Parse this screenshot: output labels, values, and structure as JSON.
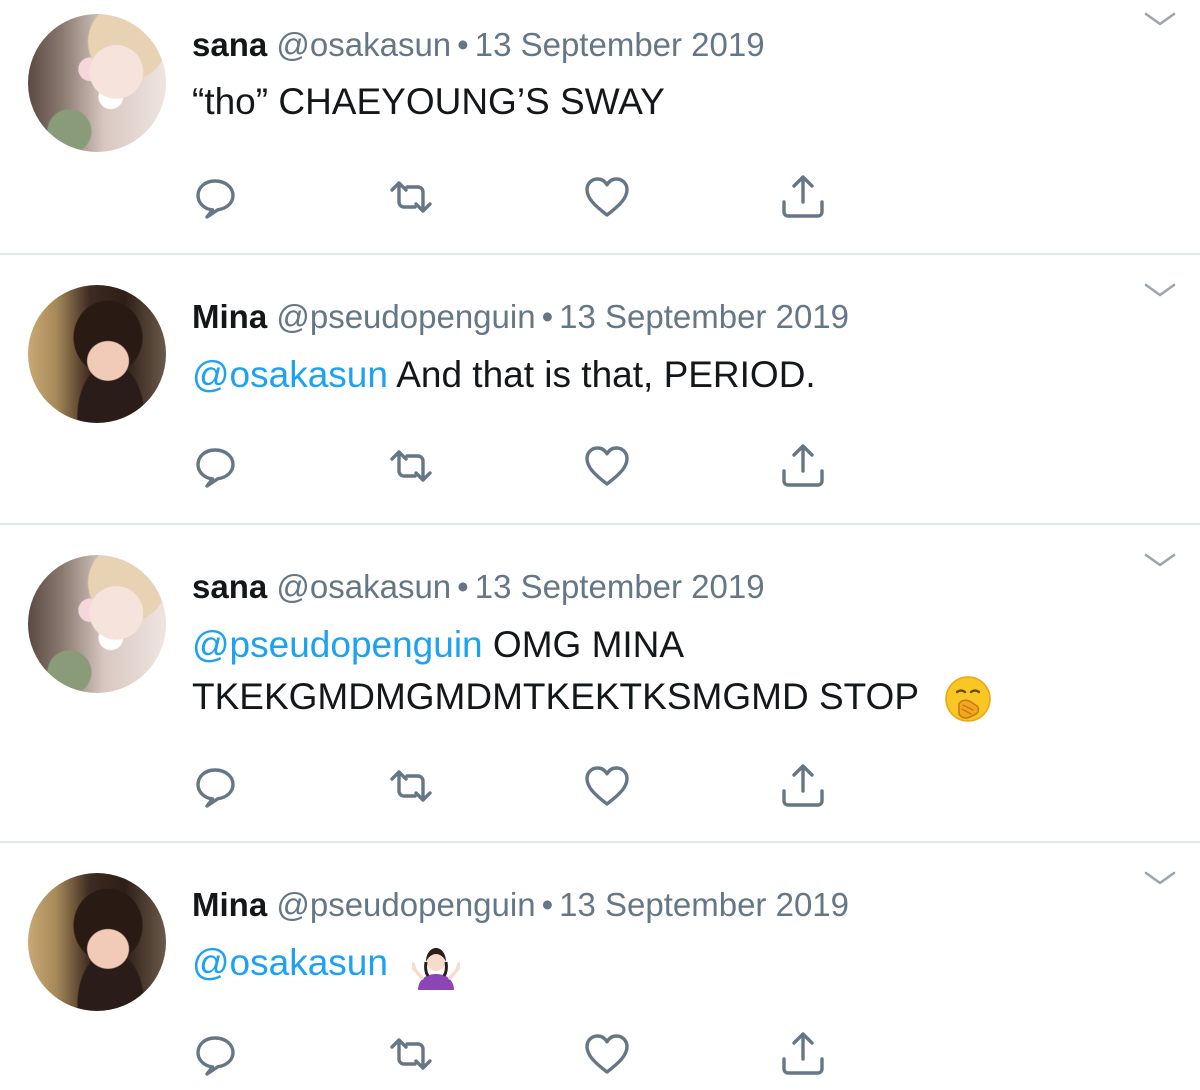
{
  "tweets": [
    {
      "name": "sana",
      "handle": "@osakasun",
      "separator": "•",
      "date": "13 September 2019",
      "mention": "",
      "text": "“tho” CHAEYOUNG’S SWAY",
      "text_line2": ""
    },
    {
      "name": "Mina",
      "handle": "@pseudopenguin",
      "separator": "•",
      "date": "13 September 2019",
      "mention": "@osakasun",
      "text": " And that is that, PERIOD.",
      "text_line2": ""
    },
    {
      "name": "sana",
      "handle": "@osakasun",
      "separator": "•",
      "date": "13 September 2019",
      "mention": "@pseudopenguin",
      "text": " OMG MINA",
      "text_line2": "TKEKGMDMGMDMTKEKTKSMGMD STOP",
      "emoji": "face-with-hand-over-mouth-emoji"
    },
    {
      "name": "Mina",
      "handle": "@pseudopenguin",
      "separator": "•",
      "date": "13 September 2019",
      "mention": "@osakasun",
      "text": "",
      "text_line2": "",
      "emoji": "person-shrugging-emoji"
    }
  ],
  "icons": {
    "reply": "reply-icon",
    "retweet": "retweet-icon",
    "like": "like-icon",
    "share": "share-icon",
    "menu": "chevron-down-icon"
  },
  "colors": {
    "mention": "#1da1f2",
    "secondary_text": "#657786",
    "icon": "#657786",
    "divider": "#e1e8ed"
  }
}
